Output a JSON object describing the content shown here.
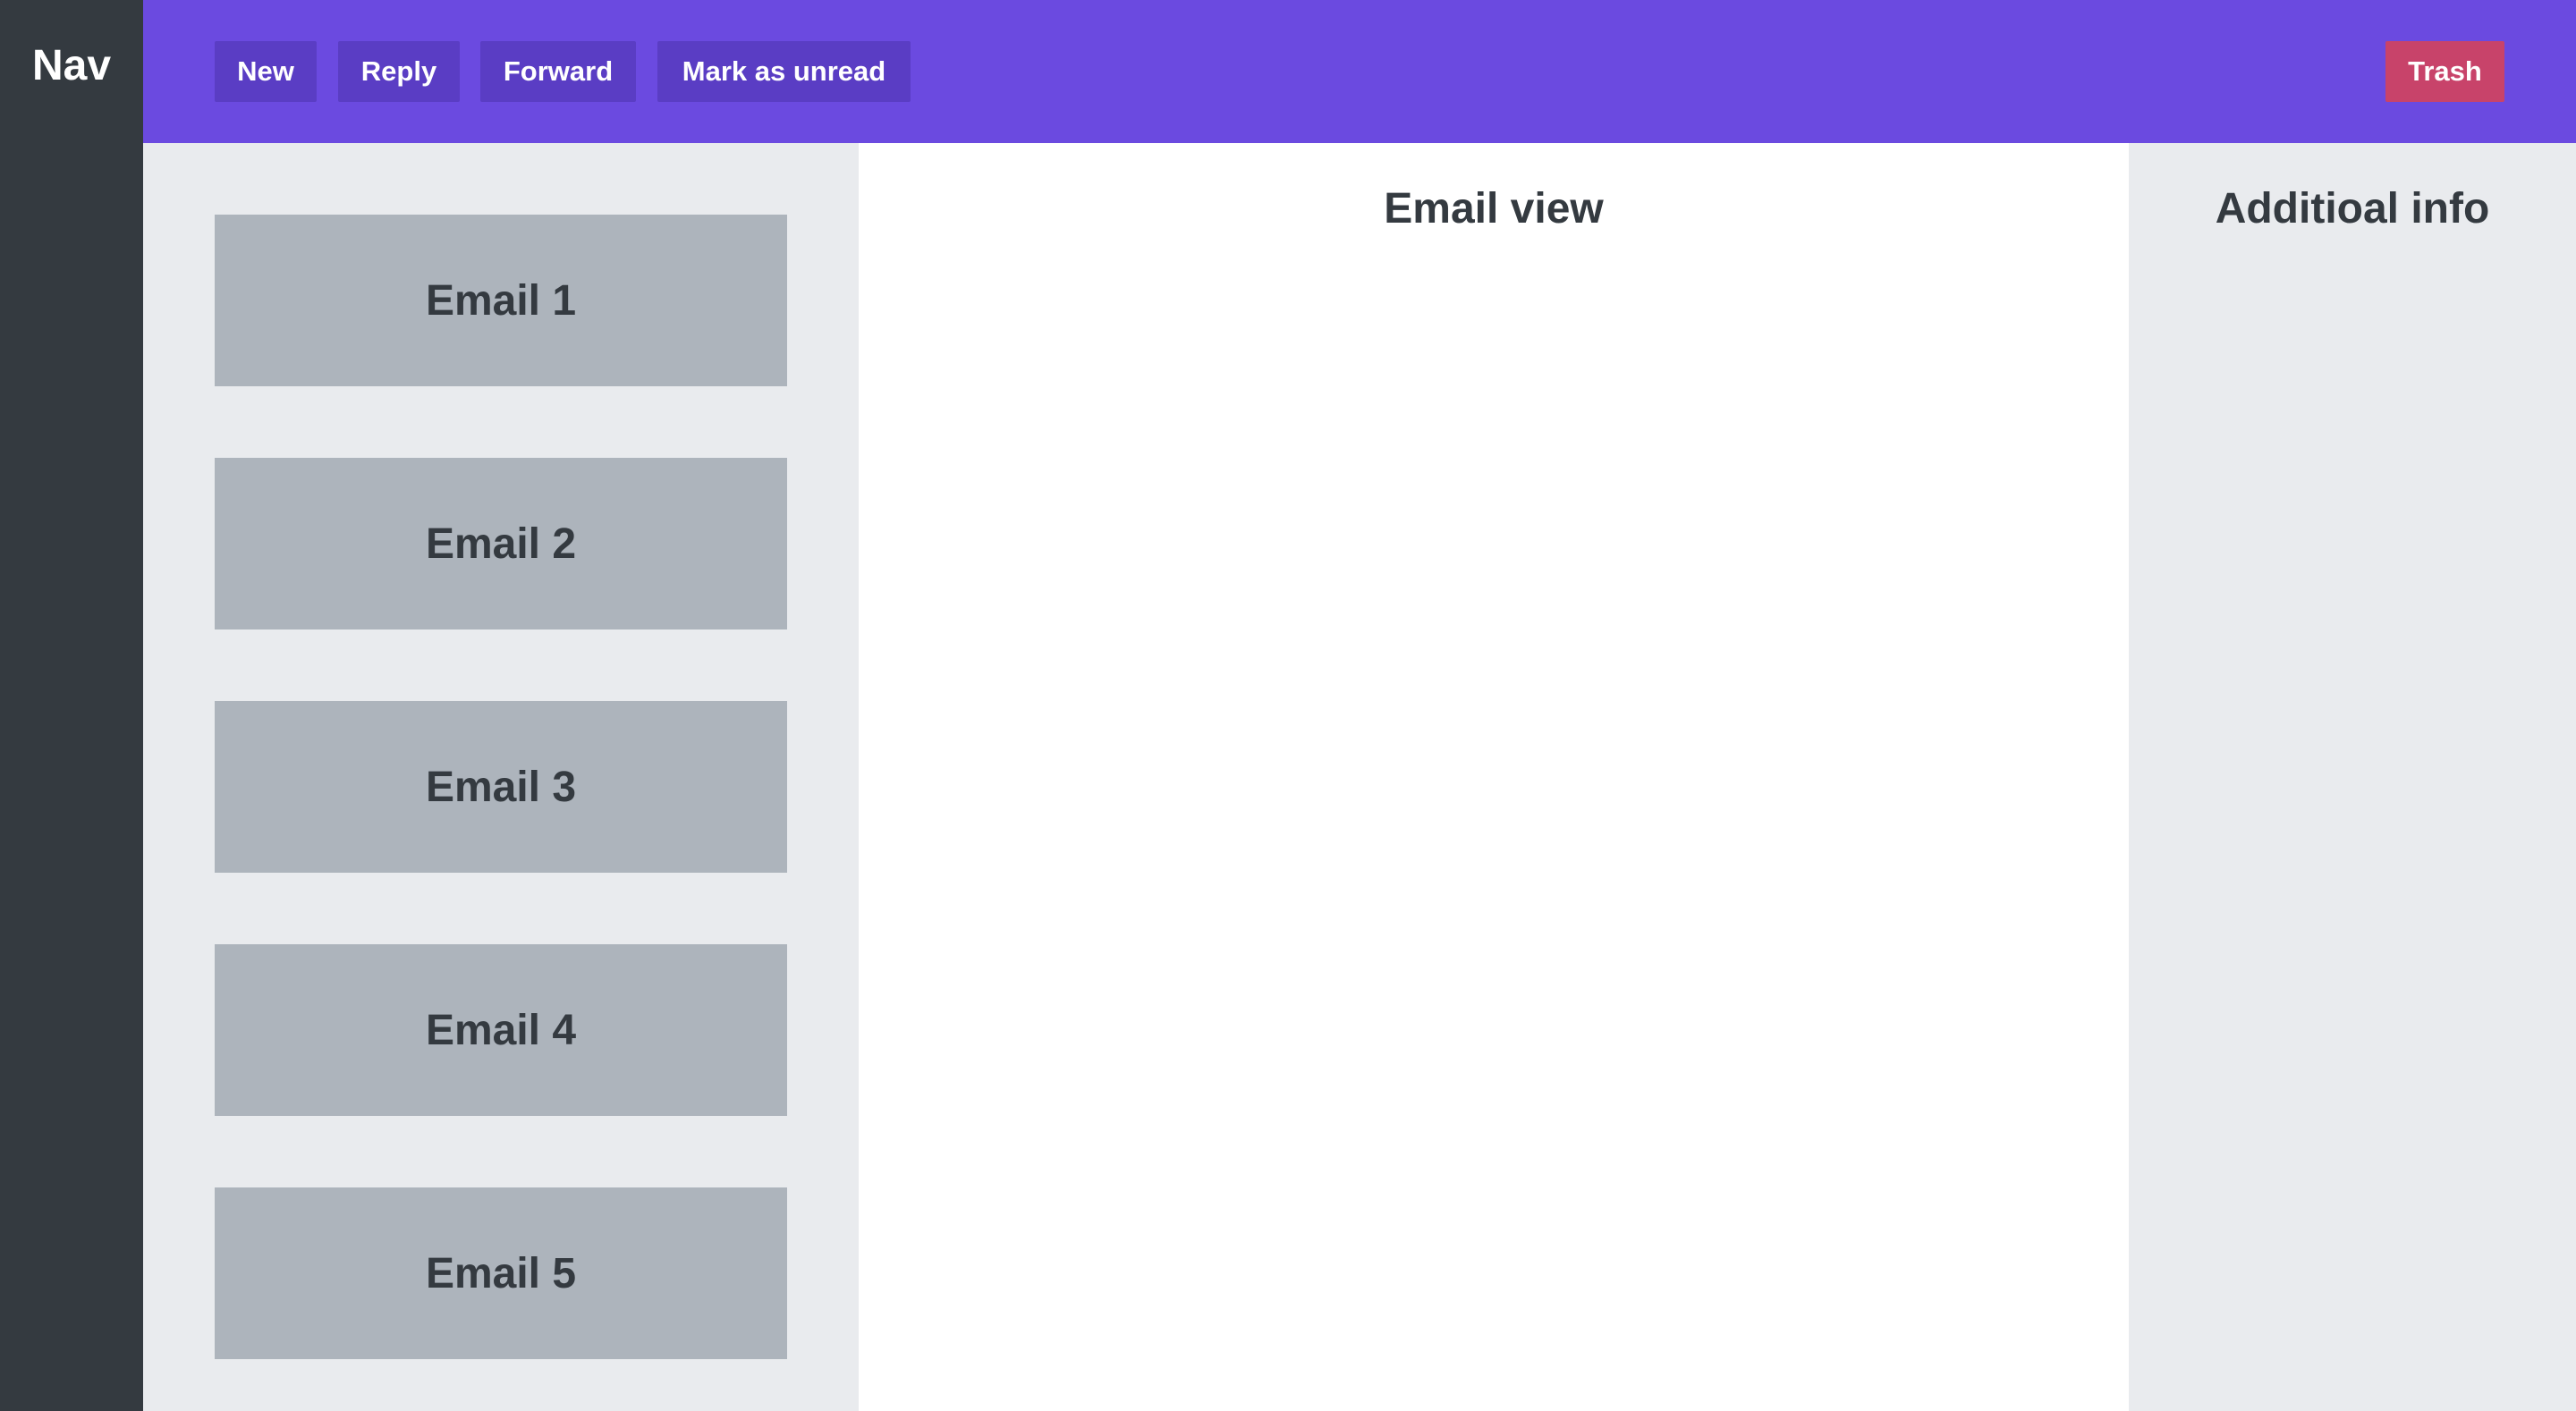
{
  "nav": {
    "title": "Nav"
  },
  "toolbar": {
    "buttons": [
      {
        "label": "New"
      },
      {
        "label": "Reply"
      },
      {
        "label": "Forward"
      },
      {
        "label": "Mark as unread"
      }
    ],
    "trash_label": "Trash"
  },
  "email_list": {
    "items": [
      {
        "label": "Email 1"
      },
      {
        "label": "Email 2"
      },
      {
        "label": "Email 3"
      },
      {
        "label": "Email 4"
      },
      {
        "label": "Email 5"
      }
    ]
  },
  "email_view": {
    "title": "Email view"
  },
  "info_panel": {
    "title": "Additioal info"
  },
  "colors": {
    "nav_bg": "#343a40",
    "toolbar_bg": "#6b4ae0",
    "button_bg": "#5a3dc4",
    "trash_bg": "#c8436a",
    "list_bg": "#e9ebee",
    "email_item_bg": "#adb4bc",
    "text_dark": "#343a40"
  }
}
